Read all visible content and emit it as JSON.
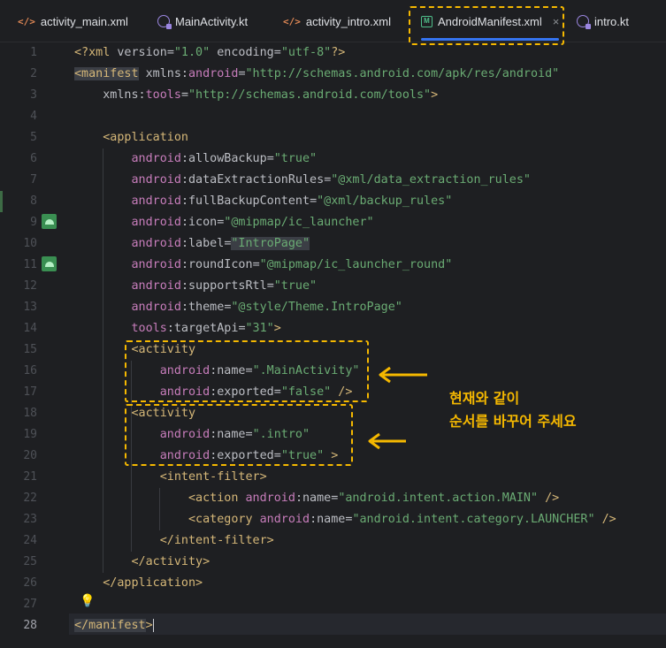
{
  "tabs": [
    {
      "label": "activity_main.xml",
      "icon": "xml-file-icon",
      "active": false
    },
    {
      "label": "MainActivity.kt",
      "icon": "kotlin-file-icon",
      "active": false
    },
    {
      "label": "activity_intro.xml",
      "icon": "xml-file-icon",
      "active": false
    },
    {
      "label": "AndroidManifest.xml",
      "icon": "manifest-file-icon",
      "active": true
    },
    {
      "label": "intro.kt",
      "icon": "kotlin-file-icon",
      "active": false
    }
  ],
  "tab_close_glyph": "×",
  "xml_glyph": "</>",
  "manifest_glyph": "M",
  "gutter": {
    "line_numbers": [
      "1",
      "2",
      "3",
      "4",
      "5",
      "6",
      "7",
      "8",
      "9",
      "10",
      "11",
      "12",
      "13",
      "14",
      "15",
      "16",
      "17",
      "18",
      "19",
      "20",
      "21",
      "22",
      "23",
      "24",
      "25",
      "26",
      "27",
      "28"
    ],
    "current_line": "28",
    "icon_lines": [
      "9",
      "11"
    ]
  },
  "code": {
    "l1": {
      "a": "<?xml ",
      "b": "version",
      "c": "=",
      "d": "\"1.0\"",
      "e": " encoding",
      "f": "=",
      "g": "\"utf-8\"",
      "h": "?>"
    },
    "l2": {
      "a": "<manifest",
      "b": " xmlns:",
      "c": "android",
      "d": "=",
      "e": "\"http://schemas.android.com/apk/res/android\""
    },
    "l3": {
      "a": "xmlns:",
      "b": "tools",
      "c": "=",
      "d": "\"http://schemas.android.com/tools\"",
      "e": ">"
    },
    "l5": {
      "a": "<application"
    },
    "l6": {
      "ns": "android",
      "attr": ":allowBackup",
      "eq": "=",
      "val": "\"true\""
    },
    "l7": {
      "ns": "android",
      "attr": ":dataExtractionRules",
      "eq": "=",
      "val": "\"@xml/data_extraction_rules\""
    },
    "l8": {
      "ns": "android",
      "attr": ":fullBackupContent",
      "eq": "=",
      "val": "\"@xml/backup_rules\""
    },
    "l9": {
      "ns": "android",
      "attr": ":icon",
      "eq": "=",
      "val": "\"@mipmap/ic_launcher\""
    },
    "l10": {
      "ns": "android",
      "attr": ":label",
      "eq": "=",
      "val": "\"IntroPage\""
    },
    "l11": {
      "ns": "android",
      "attr": ":roundIcon",
      "eq": "=",
      "val": "\"@mipmap/ic_launcher_round\""
    },
    "l12": {
      "ns": "android",
      "attr": ":supportsRtl",
      "eq": "=",
      "val": "\"true\""
    },
    "l13": {
      "ns": "android",
      "attr": ":theme",
      "eq": "=",
      "val": "\"@style/Theme.IntroPage\""
    },
    "l14": {
      "ns": "tools",
      "attr": ":targetApi",
      "eq": "=",
      "val": "\"31\"",
      "end": ">"
    },
    "l15": {
      "a": "<activity"
    },
    "l16": {
      "ns": "android",
      "attr": ":name",
      "eq": "=",
      "val": "\".MainActivity\""
    },
    "l17": {
      "ns": "android",
      "attr": ":exported",
      "eq": "=",
      "val": "\"false\"",
      "end": " />"
    },
    "l18": {
      "a": "<activity"
    },
    "l19": {
      "ns": "android",
      "attr": ":name",
      "eq": "=",
      "val": "\".intro\""
    },
    "l20": {
      "ns": "android",
      "attr": ":exported",
      "eq": "=",
      "val": "\"true\"",
      "end": " >"
    },
    "l21": {
      "a": "<intent-filter>"
    },
    "l22": {
      "a": "<action",
      "ns": " android",
      "attr": ":name",
      "eq": "=",
      "val": "\"android.intent.action.MAIN\"",
      "end": " />"
    },
    "l23": {
      "a": "<category",
      "ns": " android",
      "attr": ":name",
      "eq": "=",
      "val": "\"android.intent.category.LAUNCHER\"",
      "end": " />"
    },
    "l24": {
      "a": "</intent-filter>"
    },
    "l25": {
      "a": "</activity>"
    },
    "l26": {
      "a": "</application>"
    },
    "l28": {
      "a": "</manifest",
      "b": ">"
    }
  },
  "annotation": {
    "line1": "현재와 같이",
    "line2": "순서를 바꾸어 주세요",
    "color": "#f5b800"
  },
  "colors": {
    "tag": "#d5b778",
    "namespace": "#c77dbb",
    "string": "#6aab73",
    "accent": "#3574f0"
  }
}
